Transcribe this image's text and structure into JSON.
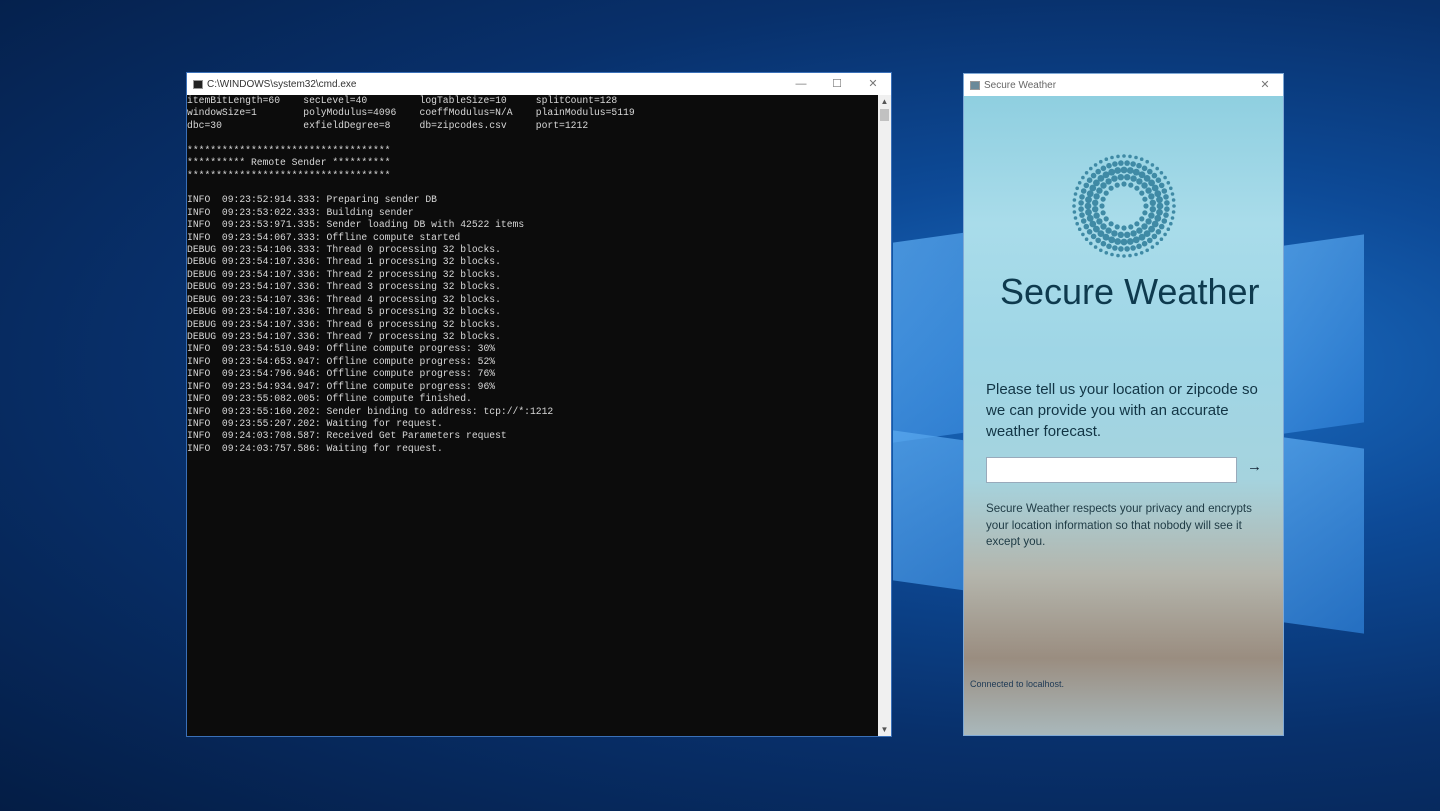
{
  "cmd": {
    "title": "C:\\WINDOWS\\system32\\cmd.exe",
    "controls": {
      "minimize": "—",
      "maximize": "☐",
      "close": "✕"
    },
    "lines": [
      "itemBitLength=60    secLevel=40         logTableSize=10     splitCount=128",
      "windowSize=1        polyModulus=4096    coeffModulus=N/A    plainModulus=5119",
      "dbc=30              exfieldDegree=8     db=zipcodes.csv     port=1212",
      "",
      "***********************************",
      "********** Remote Sender **********",
      "***********************************",
      "",
      "INFO  09:23:52:914.333: Preparing sender DB",
      "INFO  09:23:53:022.333: Building sender",
      "INFO  09:23:53:971.335: Sender loading DB with 42522 items",
      "INFO  09:23:54:067.333: Offline compute started",
      "DEBUG 09:23:54:106.333: Thread 0 processing 32 blocks.",
      "DEBUG 09:23:54:107.336: Thread 1 processing 32 blocks.",
      "DEBUG 09:23:54:107.336: Thread 2 processing 32 blocks.",
      "DEBUG 09:23:54:107.336: Thread 3 processing 32 blocks.",
      "DEBUG 09:23:54:107.336: Thread 4 processing 32 blocks.",
      "DEBUG 09:23:54:107.336: Thread 5 processing 32 blocks.",
      "DEBUG 09:23:54:107.336: Thread 6 processing 32 blocks.",
      "DEBUG 09:23:54:107.336: Thread 7 processing 32 blocks.",
      "INFO  09:23:54:510.949: Offline compute progress: 30%",
      "INFO  09:23:54:653.947: Offline compute progress: 52%",
      "INFO  09:23:54:796.946: Offline compute progress: 76%",
      "INFO  09:23:54:934.947: Offline compute progress: 96%",
      "INFO  09:23:55:082.005: Offline compute finished.",
      "INFO  09:23:55:160.202: Sender binding to address: tcp://*:1212",
      "INFO  09:23:55:207.202: Waiting for request.",
      "INFO  09:24:03:708.587: Received Get Parameters request",
      "INFO  09:24:03:757.586: Waiting for request."
    ]
  },
  "weather": {
    "window_title": "Secure Weather",
    "close": "✕",
    "app_title": "Secure Weather",
    "prompt": "Please tell us your location or zipcode so we can provide you with an accurate weather forecast.",
    "location_input_value": "",
    "submit_arrow": "→",
    "privacy": "Secure Weather respects your privacy and encrypts your location information so that nobody will see it except you.",
    "status": "Connected to localhost."
  }
}
